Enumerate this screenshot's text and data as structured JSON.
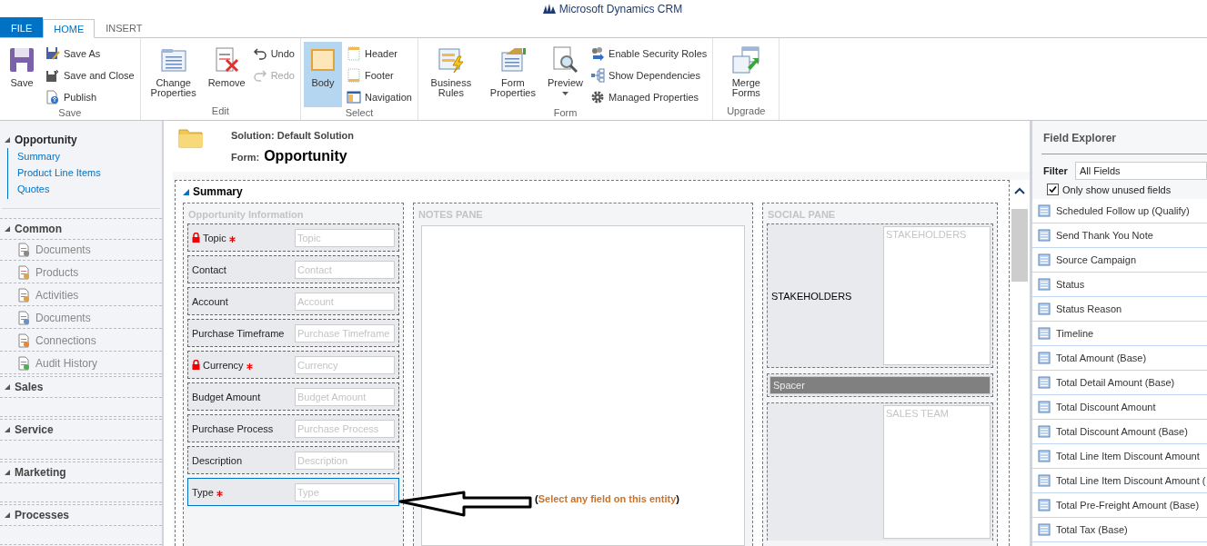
{
  "app_title": "Microsoft Dynamics CRM",
  "tabs": [
    {
      "label": "FILE",
      "kind": "file",
      "selected": false
    },
    {
      "label": "HOME",
      "kind": "tab",
      "selected": true
    },
    {
      "label": "INSERT",
      "kind": "tab",
      "selected": false
    }
  ],
  "ribbon": {
    "groups": [
      {
        "label": "Save",
        "items": [
          {
            "label": "Save",
            "kind": "large",
            "selected": false,
            "disabled": false
          },
          {
            "label": "Save As",
            "kind": "small",
            "selected": false,
            "disabled": false
          },
          {
            "label": "Save and Close",
            "kind": "small",
            "selected": false,
            "disabled": false
          },
          {
            "label": "Publish",
            "kind": "small",
            "selected": false,
            "disabled": false
          }
        ]
      },
      {
        "label": "Edit",
        "items": [
          {
            "label": "Change Properties",
            "kind": "large",
            "selected": false,
            "disabled": false
          },
          {
            "label": "Remove",
            "kind": "large",
            "selected": false,
            "disabled": false
          },
          {
            "label": "Undo",
            "kind": "small",
            "selected": false,
            "disabled": false
          },
          {
            "label": "Redo",
            "kind": "small",
            "selected": false,
            "disabled": true
          }
        ]
      },
      {
        "label": "Select",
        "items": [
          {
            "label": "Body",
            "kind": "large",
            "selected": true,
            "disabled": false
          },
          {
            "label": "Header",
            "kind": "small",
            "selected": false,
            "disabled": false
          },
          {
            "label": "Footer",
            "kind": "small",
            "selected": false,
            "disabled": false
          },
          {
            "label": "Navigation",
            "kind": "small",
            "selected": false,
            "disabled": false
          }
        ]
      },
      {
        "label": "Form",
        "items": [
          {
            "label": "Business Rules",
            "kind": "large",
            "selected": false,
            "disabled": false
          },
          {
            "label": "Form Properties",
            "kind": "large",
            "selected": false,
            "disabled": false
          },
          {
            "label": "Preview",
            "kind": "dropdown",
            "selected": false,
            "disabled": false
          },
          {
            "label": "Enable Security Roles",
            "kind": "small",
            "selected": false,
            "disabled": false
          },
          {
            "label": "Show Dependencies",
            "kind": "small",
            "selected": false,
            "disabled": false
          },
          {
            "label": "Managed Properties",
            "kind": "small",
            "selected": false,
            "disabled": false
          }
        ]
      },
      {
        "label": "Upgrade",
        "items": [
          {
            "label": "Merge Forms",
            "kind": "large",
            "selected": false,
            "disabled": false
          }
        ]
      }
    ]
  },
  "nav": {
    "entity": {
      "label": "Opportunity",
      "expanded": true
    },
    "links": [
      "Summary",
      "Product Line Items",
      "Quotes"
    ],
    "sections": [
      {
        "label": "Common",
        "expanded": true,
        "items": [
          "Documents",
          "Products",
          "Activities",
          "Documents",
          "Connections",
          "Audit History"
        ]
      },
      {
        "label": "Sales",
        "expanded": true
      },
      {
        "label": "Service",
        "expanded": true
      },
      {
        "label": "Marketing",
        "expanded": true
      },
      {
        "label": "Processes",
        "expanded": true
      }
    ]
  },
  "form_header": {
    "solution": "Solution: Default Solution",
    "form_label": "Form:",
    "form_name": "Opportunity"
  },
  "section": {
    "title": "Summary",
    "expanded": true
  },
  "opportunity_info": {
    "title": "Opportunity Information",
    "fields": [
      {
        "label": "Topic",
        "placeholder": "Topic",
        "locked": true,
        "required": true,
        "selected": false
      },
      {
        "label": "Contact",
        "placeholder": "Contact",
        "locked": false,
        "required": false,
        "selected": false
      },
      {
        "label": "Account",
        "placeholder": "Account",
        "locked": false,
        "required": false,
        "selected": false
      },
      {
        "label": "Purchase Timeframe",
        "placeholder": "Purchase Timeframe",
        "locked": false,
        "required": false,
        "selected": false
      },
      {
        "label": "Currency",
        "placeholder": "Currency",
        "locked": true,
        "required": true,
        "selected": false
      },
      {
        "label": "Budget Amount",
        "placeholder": "Budget Amount",
        "locked": false,
        "required": false,
        "selected": false
      },
      {
        "label": "Purchase Process",
        "placeholder": "Purchase Process",
        "locked": false,
        "required": false,
        "selected": false
      },
      {
        "label": "Description",
        "placeholder": "Description",
        "locked": false,
        "required": false,
        "selected": false
      },
      {
        "label": "Type",
        "placeholder": "Type",
        "locked": false,
        "required": true,
        "selected": true
      }
    ]
  },
  "notes_pane": {
    "title": "NOTES PANE"
  },
  "social_pane": {
    "title": "SOCIAL PANE",
    "stakeholders_label": "STAKEHOLDERS",
    "stakeholders_placeholder": "STAKEHOLDERS",
    "spacer": "Spacer",
    "sales_team_placeholder": "SALES TEAM"
  },
  "annotation": {
    "open": "(",
    "text": "Select any field on this entity",
    "close": ")"
  },
  "field_explorer": {
    "title": "Field Explorer",
    "filter_label": "Filter",
    "filter_value": "All Fields",
    "only_unused": {
      "label": "Only show unused fields",
      "checked": true
    },
    "fields": [
      "Scheduled Follow up (Qualify)",
      "Send Thank You Note",
      "Source Campaign",
      "Status",
      "Status Reason",
      "Timeline",
      "Total Amount (Base)",
      "Total Detail Amount (Base)",
      "Total Discount Amount",
      "Total Discount Amount (Base)",
      "Total Line Item Discount Amount",
      "Total Line Item Discount Amount (",
      "Total Pre-Freight Amount (Base)",
      "Total Tax (Base)"
    ]
  }
}
